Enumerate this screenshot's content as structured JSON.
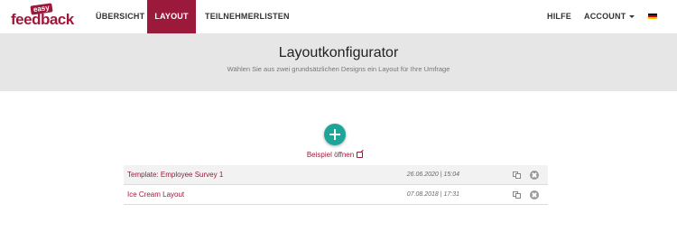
{
  "logo": {
    "easy": "easy",
    "brand": "feedback"
  },
  "nav": {
    "uebersicht": "ÜBERSICHT",
    "layout": "LAYOUT",
    "teilnehmerlisten": "TEILNEHMERLISTEN",
    "hilfe": "HILFE",
    "account": "ACCOUNT"
  },
  "hero": {
    "title": "Layoutkonfigurator",
    "subtitle": "Wählen Sie aus zwei grundsätzlichen Designs ein Layout für Ihre Umfrage"
  },
  "example_link": "Beispiel öffnen",
  "layouts": [
    {
      "name": "Template: Employee Survey 1",
      "date": "26.06.2020 | 15:04"
    },
    {
      "name": "Ice Cream Layout",
      "date": "07.08.2018 | 17:31"
    }
  ],
  "colors": {
    "brand": "#9b1a3c",
    "accent": "#1ea59a"
  },
  "icons": {
    "add": "plus-icon",
    "external": "external-link-icon",
    "copy": "copy-icon",
    "delete": "close-circle-icon",
    "language": "german-flag-icon"
  }
}
